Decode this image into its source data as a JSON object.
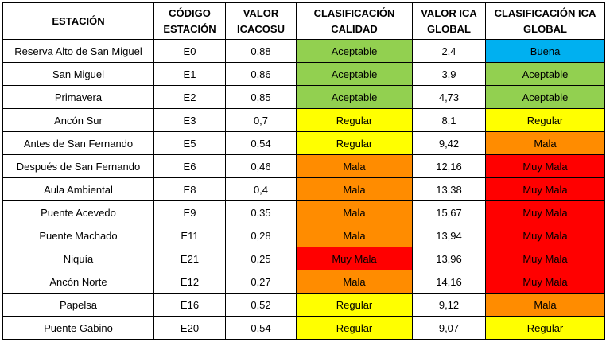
{
  "headers": [
    "ESTACIÓN",
    "CÓDIGO ESTACIÓN",
    "VALOR ICACOSU",
    "CLASIFICACIÓN CALIDAD",
    "VALOR ICA GLOBAL",
    "CLASIFICACIÓN ICA GLOBAL"
  ],
  "category_colors": {
    "Buena": "#00b0f0",
    "Aceptable": "#92d050",
    "Regular": "#ffff00",
    "Mala": "#ff8c00",
    "Muy Mala": "#ff0000"
  },
  "rows": [
    {
      "station": "Reserva Alto de San Miguel",
      "code": "E0",
      "icacosu": "0,88",
      "quality": "Aceptable",
      "ica_global": "2,4",
      "ica_class": "Buena"
    },
    {
      "station": "San Miguel",
      "code": "E1",
      "icacosu": "0,86",
      "quality": "Aceptable",
      "ica_global": "3,9",
      "ica_class": "Aceptable"
    },
    {
      "station": "Primavera",
      "code": "E2",
      "icacosu": "0,85",
      "quality": "Aceptable",
      "ica_global": "4,73",
      "ica_class": "Aceptable"
    },
    {
      "station": "Ancón Sur",
      "code": "E3",
      "icacosu": "0,7",
      "quality": "Regular",
      "ica_global": "8,1",
      "ica_class": "Regular"
    },
    {
      "station": "Antes de San Fernando",
      "code": "E5",
      "icacosu": "0,54",
      "quality": "Regular",
      "ica_global": "9,42",
      "ica_class": "Mala"
    },
    {
      "station": "Después de San Fernando",
      "code": "E6",
      "icacosu": "0,46",
      "quality": "Mala",
      "ica_global": "12,16",
      "ica_class": "Muy Mala"
    },
    {
      "station": "Aula Ambiental",
      "code": "E8",
      "icacosu": "0,4",
      "quality": "Mala",
      "ica_global": "13,38",
      "ica_class": "Muy Mala"
    },
    {
      "station": "Puente Acevedo",
      "code": "E9",
      "icacosu": "0,35",
      "quality": "Mala",
      "ica_global": "15,67",
      "ica_class": "Muy Mala"
    },
    {
      "station": "Puente Machado",
      "code": "E11",
      "icacosu": "0,28",
      "quality": "Mala",
      "ica_global": "13,94",
      "ica_class": "Muy Mala"
    },
    {
      "station": "Niquía",
      "code": "E21",
      "icacosu": "0,25",
      "quality": "Muy Mala",
      "ica_global": "13,96",
      "ica_class": "Muy Mala"
    },
    {
      "station": "Ancón Norte",
      "code": "E12",
      "icacosu": "0,27",
      "quality": "Mala",
      "ica_global": "14,16",
      "ica_class": "Muy Mala"
    },
    {
      "station": "Papelsa",
      "code": "E16",
      "icacosu": "0,52",
      "quality": "Regular",
      "ica_global": "9,12",
      "ica_class": "Mala"
    },
    {
      "station": "Puente Gabino",
      "code": "E20",
      "icacosu": "0,54",
      "quality": "Regular",
      "ica_global": "9,07",
      "ica_class": "Regular"
    }
  ]
}
